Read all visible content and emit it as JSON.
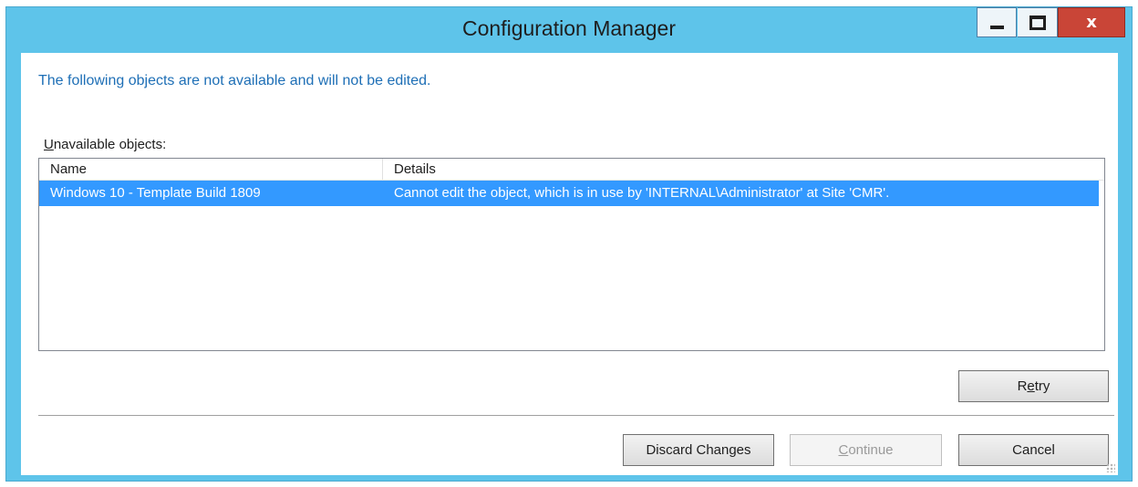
{
  "window": {
    "title": "Configuration Manager",
    "controls": {
      "minimize": "minimize",
      "maximize": "maximize",
      "close": "x"
    }
  },
  "message": "The following objects are not available and will not be edited.",
  "group_label": {
    "first": "U",
    "rest": "navailable objects:"
  },
  "list": {
    "columns": [
      "Name",
      "Details"
    ],
    "rows": [
      {
        "name": "Windows 10 - Template Build 1809",
        "details": "Cannot edit the object, which is in use by 'INTERNAL\\Administrator' at Site 'CMR'.",
        "selected": true
      }
    ]
  },
  "buttons": {
    "retry": {
      "prefix": "R",
      "accel": "e",
      "suffix": "try"
    },
    "discard": "Discard Changes",
    "continue": {
      "accel": "C",
      "suffix": "ontinue",
      "enabled": false
    },
    "cancel": "Cancel"
  },
  "colors": {
    "frame": "#5ec4ea",
    "message_text": "#1e6fb6",
    "selection": "#3399ff",
    "close_button": "#c94537"
  },
  "icons": [
    "minimize-icon",
    "maximize-icon",
    "close-icon",
    "resize-grip-icon"
  ]
}
